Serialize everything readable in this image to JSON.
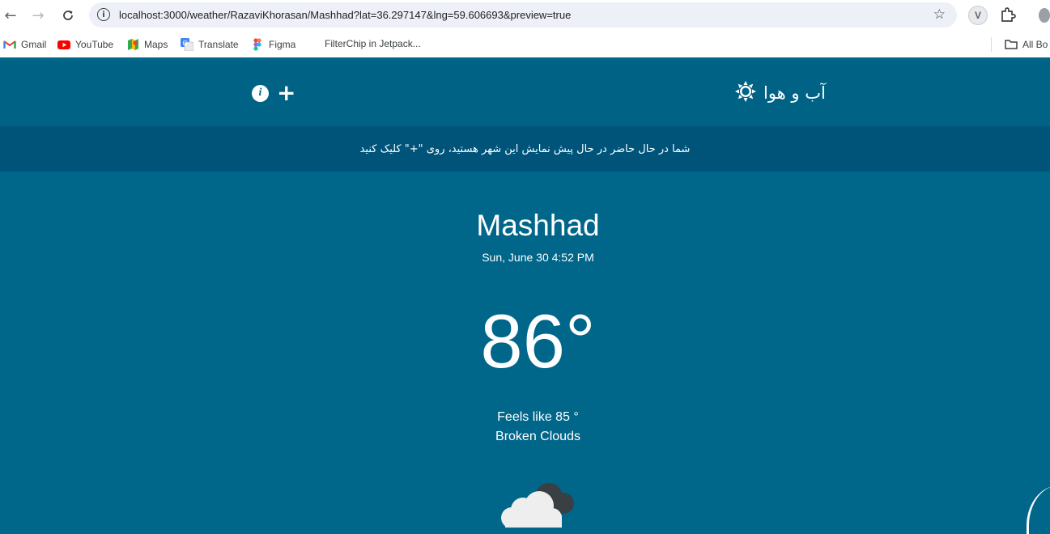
{
  "browser": {
    "url": "localhost:3000/weather/RazaviKhorasan/Mashhad?lat=36.297147&lng=59.606693&preview=true",
    "ext_avatar_letter": "V",
    "bookmarks": [
      {
        "label": "Gmail",
        "icon": "gmail-icon"
      },
      {
        "label": "YouTube",
        "icon": "youtube-icon"
      },
      {
        "label": "Maps",
        "icon": "maps-icon"
      },
      {
        "label": "Translate",
        "icon": "translate-icon"
      },
      {
        "label": "Figma",
        "icon": "figma-icon"
      },
      {
        "label": "FilterChip in Jetpack...",
        "icon": "none"
      }
    ],
    "all_bookmarks_label": "All Bo"
  },
  "header": {
    "title": "آب و هوا",
    "info_glyph": "i",
    "add_glyph": "+"
  },
  "banner": {
    "text": "شما در حال حاضر در حال پیش نمایش این شهر هستید، روی \"+\" کلیک کنید"
  },
  "weather": {
    "city": "Mashhad",
    "datetime": "Sun, June 30 4:52 PM",
    "temperature": "86°",
    "feels_like": "Feels like 85 °",
    "condition": "Broken Clouds"
  },
  "colors": {
    "header_bg": "#006386",
    "banner_bg": "#00547a",
    "main_bg": "#00668a",
    "text": "#ffffff"
  }
}
